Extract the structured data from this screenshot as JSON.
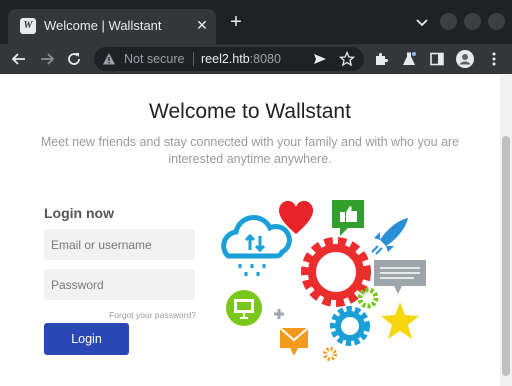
{
  "browser": {
    "tab": {
      "favicon_text": "W",
      "title": "Welcome | Wallstant",
      "close": "✕"
    },
    "new_tab": "+",
    "omnibox": {
      "security_label": "Not secure",
      "url_host": "reel2.htb",
      "url_port": ":8080"
    }
  },
  "page": {
    "title": "Welcome to Wallstant",
    "subtitle": "Meet new friends and stay connected with your family and with who you are interested anytime anywhere."
  },
  "login": {
    "heading": "Login now",
    "username_placeholder": "Email or username",
    "password_placeholder": "Password",
    "forgot_label": "Forgot your password?",
    "button_label": "Login"
  },
  "colors": {
    "accent": "#2a48b5",
    "heart": "#e8232a",
    "gear_red": "#ec2d2d",
    "cloud": "#1b9fd8",
    "like": "#33a02c",
    "rocket": "#2a8fd6",
    "star": "#f6d70f",
    "mail": "#f39a1c"
  }
}
